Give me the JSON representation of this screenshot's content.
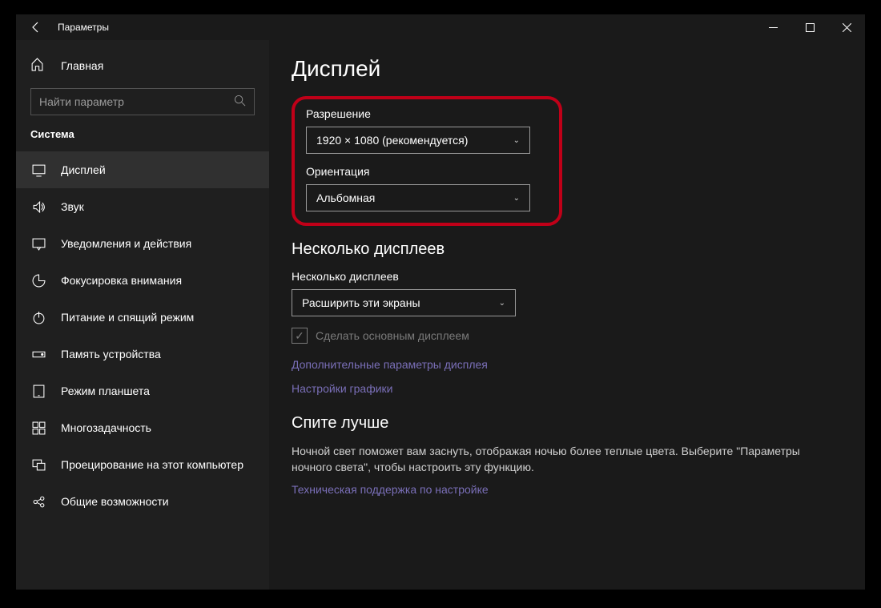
{
  "header": {
    "app_title": "Параметры"
  },
  "sidebar": {
    "home_label": "Главная",
    "search_placeholder": "Найти параметр",
    "category": "Система",
    "items": [
      {
        "label": "Дисплей"
      },
      {
        "label": "Звук"
      },
      {
        "label": "Уведомления и действия"
      },
      {
        "label": "Фокусировка внимания"
      },
      {
        "label": "Питание и спящий режим"
      },
      {
        "label": "Память устройства"
      },
      {
        "label": "Режим планшета"
      },
      {
        "label": "Многозадачность"
      },
      {
        "label": "Проецирование на этот компьютер"
      },
      {
        "label": "Общие возможности"
      }
    ]
  },
  "content": {
    "page_title": "Дисплей",
    "resolution": {
      "label": "Разрешение",
      "value": "1920 × 1080 (рекомендуется)"
    },
    "orientation": {
      "label": "Ориентация",
      "value": "Альбомная"
    },
    "multi_displays": {
      "heading": "Несколько дисплеев",
      "label": "Несколько дисплеев",
      "value": "Расширить эти экраны",
      "checkbox_label": "Сделать основным дисплеем"
    },
    "links": {
      "advanced_display": "Дополнительные параметры дисплея",
      "graphics_settings": "Настройки графики"
    },
    "sleep_better": {
      "heading": "Спите лучше",
      "description": "Ночной свет поможет вам заснуть, отображая ночью более теплые цвета. Выберите \"Параметры ночного света\", чтобы настроить эту функцию.",
      "support_link": "Техническая поддержка по настройке"
    }
  }
}
